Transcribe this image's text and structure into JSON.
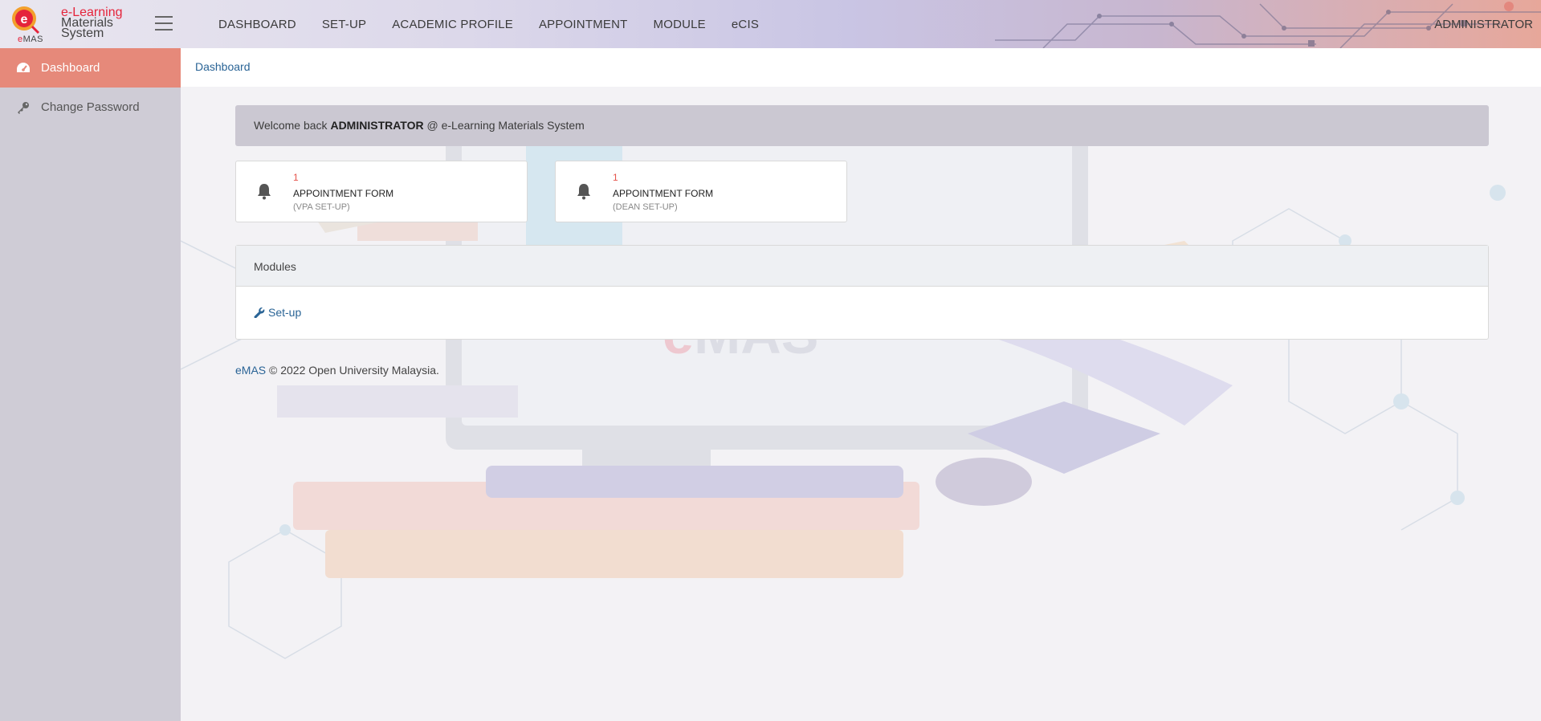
{
  "brand": {
    "line1": "e-Learning",
    "line2": "Materials",
    "line3": "System",
    "short_prefix": "e",
    "short_suffix": "MAS",
    "accent_color": "#e5243b"
  },
  "topnav": {
    "items": [
      {
        "label": "DASHBOARD"
      },
      {
        "label": "SET-UP"
      },
      {
        "label": "ACADEMIC PROFILE"
      },
      {
        "label": "APPOINTMENT"
      },
      {
        "label": "MODULE"
      },
      {
        "label": "eCIS"
      }
    ],
    "user": "ADMINISTRATOR"
  },
  "sidebar": {
    "items": [
      {
        "label": "Dashboard",
        "icon": "dashboard-gauge-icon",
        "active": true
      },
      {
        "label": "Change Password",
        "icon": "key-icon",
        "active": false
      }
    ],
    "active_color": "#e6897a"
  },
  "breadcrumb": {
    "current": "Dashboard"
  },
  "welcome": {
    "prefix": "Welcome back",
    "user": "ADMINISTRATOR",
    "suffix": "@ e-Learning Materials System"
  },
  "cards": [
    {
      "count": "1",
      "title": "APPOINTMENT FORM",
      "subtitle": "(VPA SET-UP)",
      "icon": "bell-icon"
    },
    {
      "count": "1",
      "title": "APPOINTMENT FORM",
      "subtitle": "(DEAN SET-UP)",
      "icon": "bell-icon"
    }
  ],
  "modules": {
    "heading": "Modules",
    "link_label": "Set-up",
    "link_icon": "wrench-icon"
  },
  "footer": {
    "brand_link": "eMAS",
    "text": "© 2022 Open University Malaysia."
  },
  "background": {
    "watermark": "eMAS"
  }
}
